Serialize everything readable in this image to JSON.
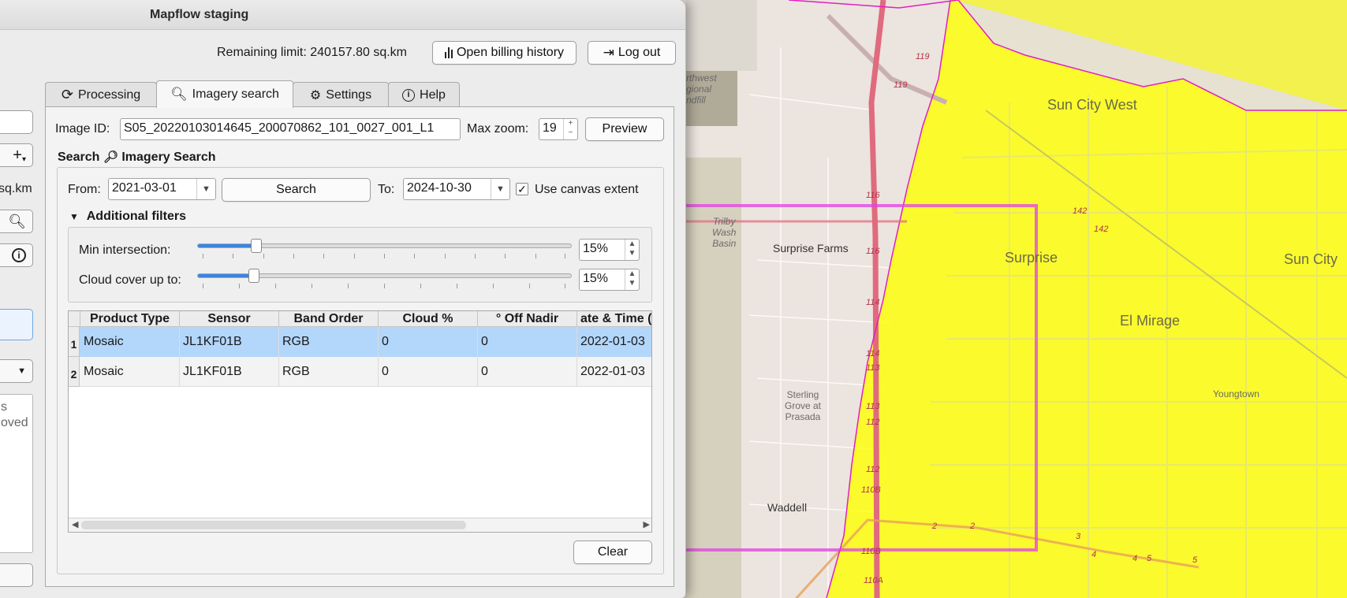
{
  "window": {
    "title": "Mapflow staging"
  },
  "header": {
    "remaining_limit": "Remaining limit: 240157.80 sq.km",
    "billing_button": "Open billing history",
    "logout_button": "Log out"
  },
  "side_panel": {
    "sq_km_text": "sq.km",
    "plus_label": "+",
    "text_line1": "s",
    "text_line2": "oved"
  },
  "tabs": [
    {
      "label": "Processing",
      "icon": "refresh-icon"
    },
    {
      "label": "Imagery search",
      "icon": "search-icon",
      "active": true
    },
    {
      "label": "Settings",
      "icon": "gears-icon"
    },
    {
      "label": "Help",
      "icon": "info-icon"
    }
  ],
  "imagery": {
    "image_id_label": "Image ID:",
    "image_id_value": "S05_20220103014645_200070862_101_0027_001_L1",
    "max_zoom_label": "Max zoom:",
    "max_zoom_value": "19",
    "preview_button": "Preview",
    "search_title": "Search",
    "search_subtitle": "Imagery Search",
    "from_label": "From:",
    "from_value": "2021-03-01",
    "search_button": "Search",
    "to_label": "To:",
    "to_value": "2024-10-30",
    "canvas_extent_label": "Use canvas extent",
    "canvas_extent_checked": true,
    "filters_label": "Additional filters",
    "min_intersection_label": "Min intersection:",
    "min_intersection_value": "15%",
    "cloud_cover_label": "Cloud cover up to:",
    "cloud_cover_value": "15%",
    "clear_button": "Clear"
  },
  "table": {
    "columns": [
      "Product Type",
      "Sensor",
      "Band Order",
      "Cloud %",
      "° Off Nadir",
      "ate & Time ("
    ],
    "rows": [
      {
        "num": "1",
        "cells": [
          "Mosaic",
          "JL1KF01B",
          "RGB",
          "0",
          "0",
          "2022-01-03"
        ],
        "selected": true
      },
      {
        "num": "2",
        "cells": [
          "Mosaic",
          "JL1KF01B",
          "RGB",
          "0",
          "0",
          "2022-01-03"
        ],
        "selected": false
      }
    ]
  },
  "map": {
    "places": [
      "Sun City West",
      "Surprise",
      "Sun City",
      "El Mirage",
      "Youngtown",
      "Surprise Farms",
      "Waddell"
    ],
    "landmarks": [
      "rthwest",
      "gional",
      "ndfill",
      "Trilby",
      "Wash",
      "Basin",
      "Sterling",
      "Grove at",
      "Prasada"
    ],
    "road_labels": [
      "119",
      "119",
      "116",
      "116",
      "114",
      "114",
      "113",
      "113",
      "112",
      "112",
      "110B",
      "110B",
      "110A",
      "142",
      "142",
      "2",
      "2",
      "3",
      "4",
      "4",
      "5",
      "5"
    ]
  },
  "colors": {
    "accent": "#3a84e0",
    "selection": "#b3d6fb",
    "map_overlay": "#ffff00",
    "aoi_outline": "#e040e0"
  }
}
